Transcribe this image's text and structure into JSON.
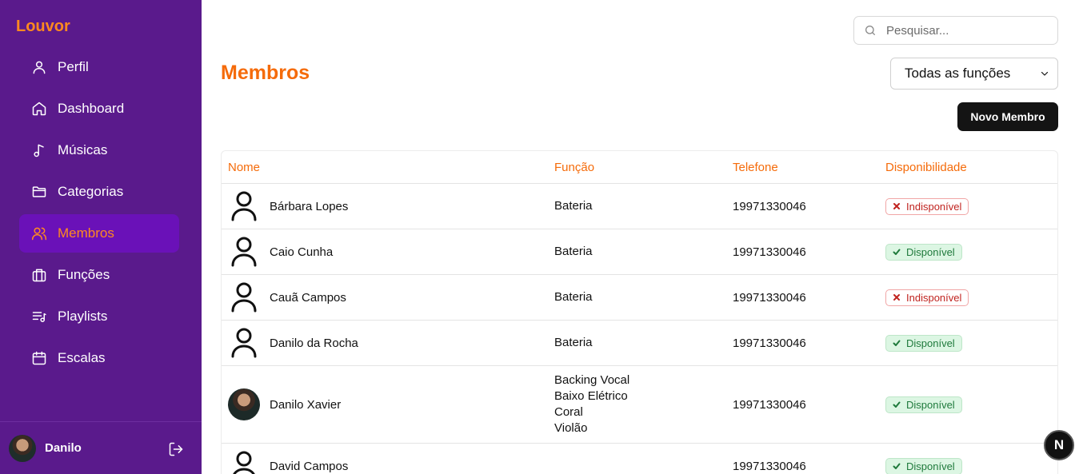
{
  "app": {
    "brand": "Louvor"
  },
  "sidebar": {
    "items": [
      {
        "label": "Perfil",
        "icon": "user-icon",
        "active": false
      },
      {
        "label": "Dashboard",
        "icon": "home-icon",
        "active": false
      },
      {
        "label": "Músicas",
        "icon": "music-note-icon",
        "active": false
      },
      {
        "label": "Categorias",
        "icon": "folder-icon",
        "active": false
      },
      {
        "label": "Membros",
        "icon": "users-icon",
        "active": true
      },
      {
        "label": "Funções",
        "icon": "briefcase-icon",
        "active": false
      },
      {
        "label": "Playlists",
        "icon": "playlist-icon",
        "active": false
      },
      {
        "label": "Escalas",
        "icon": "calendar-icon",
        "active": false
      }
    ],
    "user": {
      "name": "Danilo"
    }
  },
  "search": {
    "placeholder": "Pesquisar...",
    "value": ""
  },
  "page": {
    "title": "Membros"
  },
  "filter": {
    "selected": "Todas as funções"
  },
  "actions": {
    "new_member": "Novo Membro"
  },
  "table": {
    "columns": [
      "Nome",
      "Função",
      "Telefone",
      "Disponibilidade"
    ],
    "rows": [
      {
        "name": "Bárbara Lopes",
        "avatar": "placeholder",
        "roles": [
          "Bateria"
        ],
        "phone": "19971330046",
        "availability": "Indisponível",
        "available": false
      },
      {
        "name": "Caio Cunha",
        "avatar": "placeholder",
        "roles": [
          "Bateria"
        ],
        "phone": "19971330046",
        "availability": "Disponível",
        "available": true
      },
      {
        "name": "Cauã Campos",
        "avatar": "placeholder",
        "roles": [
          "Bateria"
        ],
        "phone": "19971330046",
        "availability": "Indisponível",
        "available": false
      },
      {
        "name": "Danilo da Rocha",
        "avatar": "placeholder",
        "roles": [
          "Bateria"
        ],
        "phone": "19971330046",
        "availability": "Disponível",
        "available": true
      },
      {
        "name": "Danilo Xavier",
        "avatar": "photo",
        "roles": [
          "Backing Vocal",
          "Baixo Elétrico",
          "Coral",
          "Violão"
        ],
        "phone": "19971330046",
        "availability": "Disponível",
        "available": true
      },
      {
        "name": "David Campos",
        "avatar": "placeholder",
        "roles": [],
        "phone": "19971330046",
        "availability": "Disponível",
        "available": true
      }
    ]
  },
  "dev_indicator": {
    "label": "N"
  },
  "colors": {
    "sidebar": "#5a1a8c",
    "active_item": "#6a11b8",
    "accent": "#f56b0a",
    "button": "#141414"
  }
}
